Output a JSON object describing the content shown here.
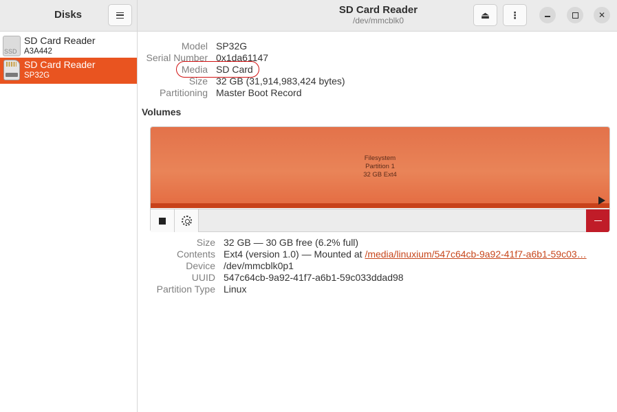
{
  "header": {
    "app_title": "Disks",
    "window_title": "SD Card Reader",
    "window_subtitle": "/dev/mmcblk0"
  },
  "sidebar": {
    "items": [
      {
        "name": "SD Card Reader",
        "sub": "A3A442",
        "icon": "ssd-drive-icon",
        "icon_label": "SSD",
        "selected": false
      },
      {
        "name": "SD Card Reader",
        "sub": "SP32G",
        "icon": "sd-card-icon",
        "selected": true
      }
    ]
  },
  "drive_info": {
    "model_key": "Model",
    "model_val": "SP32G",
    "serial_key": "Serial Number",
    "serial_val": "0x1da61147",
    "media_key": "Media",
    "media_val": "SD Card",
    "size_key": "Size",
    "size_val": "32 GB (31,914,983,424 bytes)",
    "partitioning_key": "Partitioning",
    "partitioning_val": "Master Boot Record"
  },
  "volumes": {
    "heading": "Volumes",
    "partition_line1": "Filesystem",
    "partition_line2": "Partition 1",
    "partition_line3": "32 GB Ext4",
    "usage_fraction": 0.062
  },
  "volume_info": {
    "size_key": "Size",
    "size_val": "32 GB — 30 GB free (6.2% full)",
    "contents_key": "Contents",
    "contents_prefix": "Ext4 (version 1.0) — Mounted at ",
    "contents_link": "/media/linuxium/547c64cb-9a92-41f7-a6b1-59c03…",
    "device_key": "Device",
    "device_val": "/dev/mmcblk0p1",
    "uuid_key": "UUID",
    "uuid_val": "547c64cb-9a92-41f7-a6b1-59c033ddad98",
    "ptype_key": "Partition Type",
    "ptype_val": "Linux"
  },
  "colors": {
    "accent": "#e95420",
    "destructive": "#c01c28",
    "highlight_circle": "#d01010"
  }
}
